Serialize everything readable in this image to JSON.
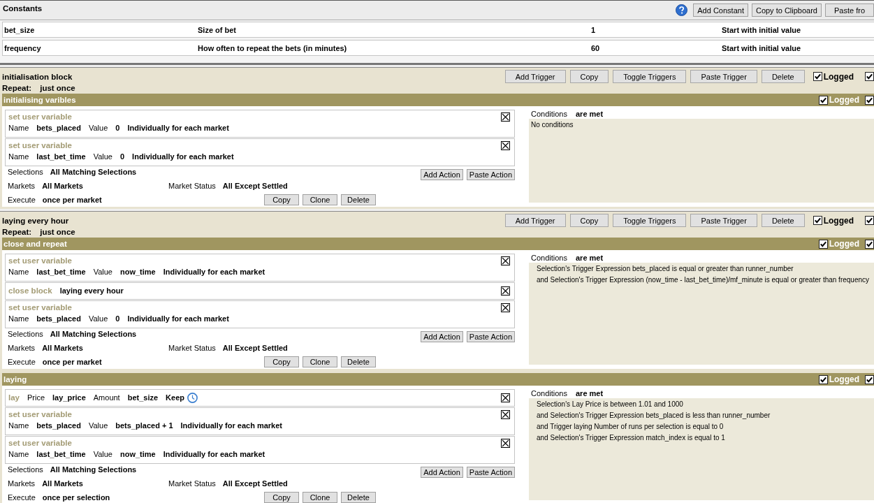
{
  "constants": {
    "title": "Constants",
    "buttons": [
      "Add Constant",
      "Copy to Clipboard",
      "Paste fro"
    ],
    "rows": [
      {
        "name": "bet_size",
        "description": "Size of bet",
        "value": "1",
        "mode": "Start with initial value"
      },
      {
        "name": "frequency",
        "description": "How often to repeat the bets (in minutes)",
        "value": "60",
        "mode": "Start with initial value"
      }
    ]
  },
  "blocks": [
    {
      "title": "initialisation block",
      "repeat_label": "Repeat:",
      "repeat": "just once",
      "buttons": [
        "Add Trigger",
        "Copy",
        "Toggle Triggers",
        "Paste Trigger",
        "Delete"
      ],
      "checkboxes": [
        {
          "label": "Logged",
          "checked": true
        },
        {
          "checked": true
        }
      ],
      "triggers": [
        {
          "title": "initialising varibles",
          "checkboxes": [
            {
              "label": "Logged",
              "checked": true
            },
            {
              "checked": true
            }
          ],
          "actions": [
            {
              "kind": "set_variable",
              "title": "set user variable",
              "fields": [
                {
                  "label": "Name",
                  "value": "bets_placed"
                },
                {
                  "label": "Value",
                  "value": "0"
                }
              ],
              "scope": "Individually for each market"
            },
            {
              "kind": "set_variable",
              "title": "set user variable",
              "fields": [
                {
                  "label": "Name",
                  "value": "last_bet_time"
                },
                {
                  "label": "Value",
                  "value": "0"
                }
              ],
              "scope": "Individually for each market"
            }
          ],
          "settings": {
            "selections": {
              "label": "Selections",
              "value": "All Matching Selections"
            },
            "markets": {
              "label": "Markets",
              "value": "All Markets"
            },
            "market_status": {
              "label": "Market Status",
              "value": "All Except Settled"
            },
            "execute": {
              "label": "Execute",
              "value": "once per market"
            }
          },
          "action_buttons": [
            "Add Action",
            "Paste Action"
          ],
          "buttons": [
            "Copy",
            "Clone",
            "Delete"
          ],
          "conditions": {
            "label": "Conditions",
            "value": "are met",
            "note": "No conditions"
          }
        }
      ]
    },
    {
      "title": "laying every hour",
      "repeat_label": "Repeat:",
      "repeat": "just once",
      "buttons": [
        "Add Trigger",
        "Copy",
        "Toggle Triggers",
        "Paste Trigger",
        "Delete"
      ],
      "checkboxes": [
        {
          "label": "Logged",
          "checked": true
        },
        {
          "checked": true
        }
      ],
      "triggers": [
        {
          "title": "close and repeat",
          "checkboxes": [
            {
              "label": "Logged",
              "checked": true
            },
            {
              "checked": true
            }
          ],
          "actions": [
            {
              "kind": "set_variable",
              "title": "set user variable",
              "fields": [
                {
                  "label": "Name",
                  "value": "last_bet_time"
                },
                {
                  "label": "Value",
                  "value": "now_time"
                }
              ],
              "scope": "Individually for each market"
            },
            {
              "kind": "close_block",
              "title": "close block",
              "value": "laying every hour"
            },
            {
              "kind": "set_variable",
              "title": "set user variable",
              "fields": [
                {
                  "label": "Name",
                  "value": "bets_placed"
                },
                {
                  "label": "Value",
                  "value": "0"
                }
              ],
              "scope": "Individually for each market"
            }
          ],
          "settings": {
            "selections": {
              "label": "Selections",
              "value": "All Matching Selections"
            },
            "markets": {
              "label": "Markets",
              "value": "All Markets"
            },
            "market_status": {
              "label": "Market Status",
              "value": "All Except Settled"
            },
            "execute": {
              "label": "Execute",
              "value": "once per market"
            }
          },
          "action_buttons": [
            "Add Action",
            "Paste Action"
          ],
          "buttons": [
            "Copy",
            "Clone",
            "Delete"
          ],
          "conditions": {
            "label": "Conditions",
            "value": "are met",
            "lines": [
              "Selection's Trigger Expression bets_placed is equal or greater than runner_number",
              "and Selection's Trigger Expression (now_time - last_bet_time)/mf_minute is equal or greater than frequency"
            ]
          }
        },
        {
          "title": "laying",
          "checkboxes": [
            {
              "label": "Logged",
              "checked": true
            },
            {
              "checked": true
            }
          ],
          "actions": [
            {
              "kind": "lay",
              "title": "lay",
              "fields": [
                {
                  "label": "Price",
                  "value": "lay_price"
                },
                {
                  "label": "Amount",
                  "value": "bet_size"
                }
              ],
              "scope": "Keep"
            },
            {
              "kind": "set_variable",
              "title": "set user variable",
              "fields": [
                {
                  "label": "Name",
                  "value": "bets_placed"
                },
                {
                  "label": "Value",
                  "value": "bets_placed + 1"
                }
              ],
              "scope": "Individually for each market"
            },
            {
              "kind": "set_variable",
              "title": "set user variable",
              "fields": [
                {
                  "label": "Name",
                  "value": "last_bet_time"
                },
                {
                  "label": "Value",
                  "value": "now_time"
                }
              ],
              "scope": "Individually for each market"
            }
          ],
          "settings": {
            "selections": {
              "label": "Selections",
              "value": "All Matching Selections"
            },
            "markets": {
              "label": "Markets",
              "value": "All Markets"
            },
            "market_status": {
              "label": "Market Status",
              "value": "All Except Settled"
            },
            "execute": {
              "label": "Execute",
              "value": "once per selection"
            }
          },
          "action_buttons": [
            "Add Action",
            "Paste Action"
          ],
          "buttons": [
            "Copy",
            "Clone",
            "Delete"
          ],
          "conditions": {
            "label": "Conditions",
            "value": "are met",
            "lines": [
              "Selection's Lay Price is between 1.01 and 1000",
              "and Selection's Trigger Expression bets_placed is less than runner_number",
              "and Trigger laying Number of runs per selection is equal to 0",
              "and Selection's Trigger Expression match_index is equal to 1"
            ]
          }
        }
      ]
    }
  ]
}
